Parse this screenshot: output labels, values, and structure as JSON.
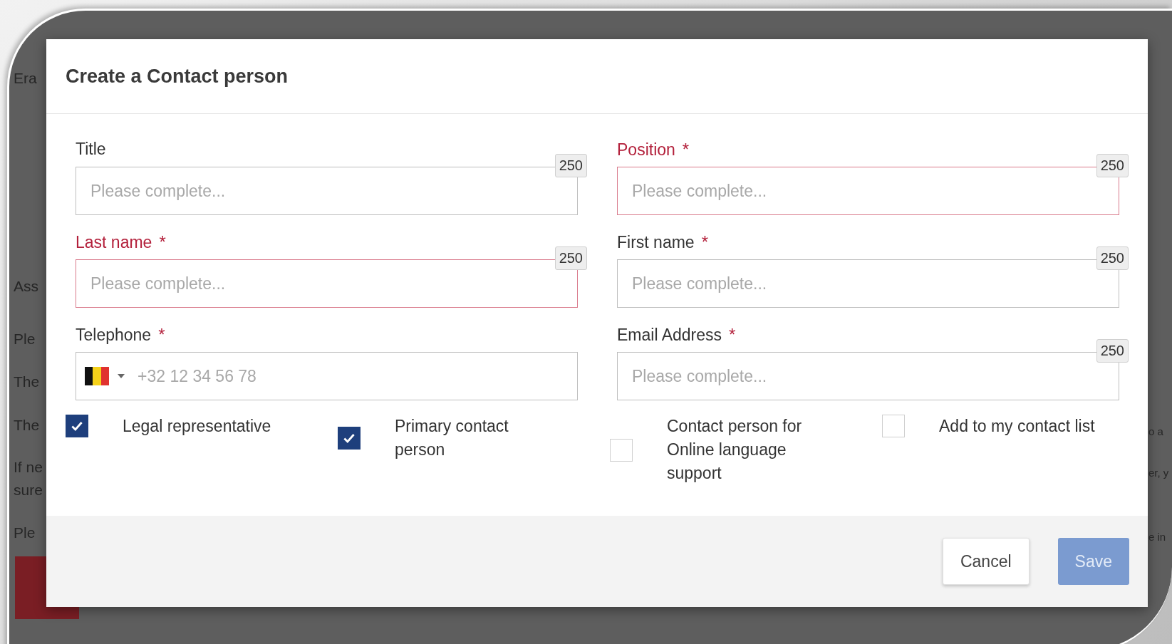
{
  "background": {
    "left_fragments": [
      "Era",
      "Ass",
      "Ple",
      "The",
      "The",
      "If ne",
      "sure",
      "Ple"
    ],
    "right_fragments": [
      "o a",
      "er, y",
      "e in"
    ]
  },
  "dialog": {
    "title": "Create a Contact person",
    "fields": [
      {
        "kind": "text",
        "label": "Title",
        "invalid": false,
        "placeholder": "Please complete...",
        "counter": "250"
      },
      {
        "kind": "text",
        "label": "Position",
        "required_mark": "*",
        "invalid": true,
        "placeholder": "Please complete...",
        "counter": "250"
      },
      {
        "kind": "text",
        "label": "Last name",
        "required_mark": "*",
        "invalid": true,
        "placeholder": "Please complete...",
        "counter": "250"
      },
      {
        "kind": "text",
        "label": "First name",
        "required_mark": "*",
        "invalid": false,
        "placeholder": "Please complete...",
        "counter": "250"
      },
      {
        "kind": "phone",
        "label": "Telephone",
        "required_mark": "*",
        "invalid": false,
        "placeholder": "+32 12 34 56 78"
      },
      {
        "kind": "text",
        "label": "Email Address",
        "required_mark": "*",
        "invalid": false,
        "placeholder": "Please complete...",
        "counter": "250"
      }
    ],
    "checkboxes": [
      {
        "label": "Legal representative",
        "checked": true
      },
      {
        "label": "Primary contact person",
        "checked": true
      },
      {
        "label": "Contact person for Online language support",
        "checked": false
      },
      {
        "label": "Add to my contact list",
        "checked": false
      }
    ],
    "buttons": [
      {
        "label": "Cancel",
        "kind": "secondary",
        "disabled": false
      },
      {
        "label": "Save",
        "kind": "primary",
        "disabled": true
      }
    ]
  }
}
